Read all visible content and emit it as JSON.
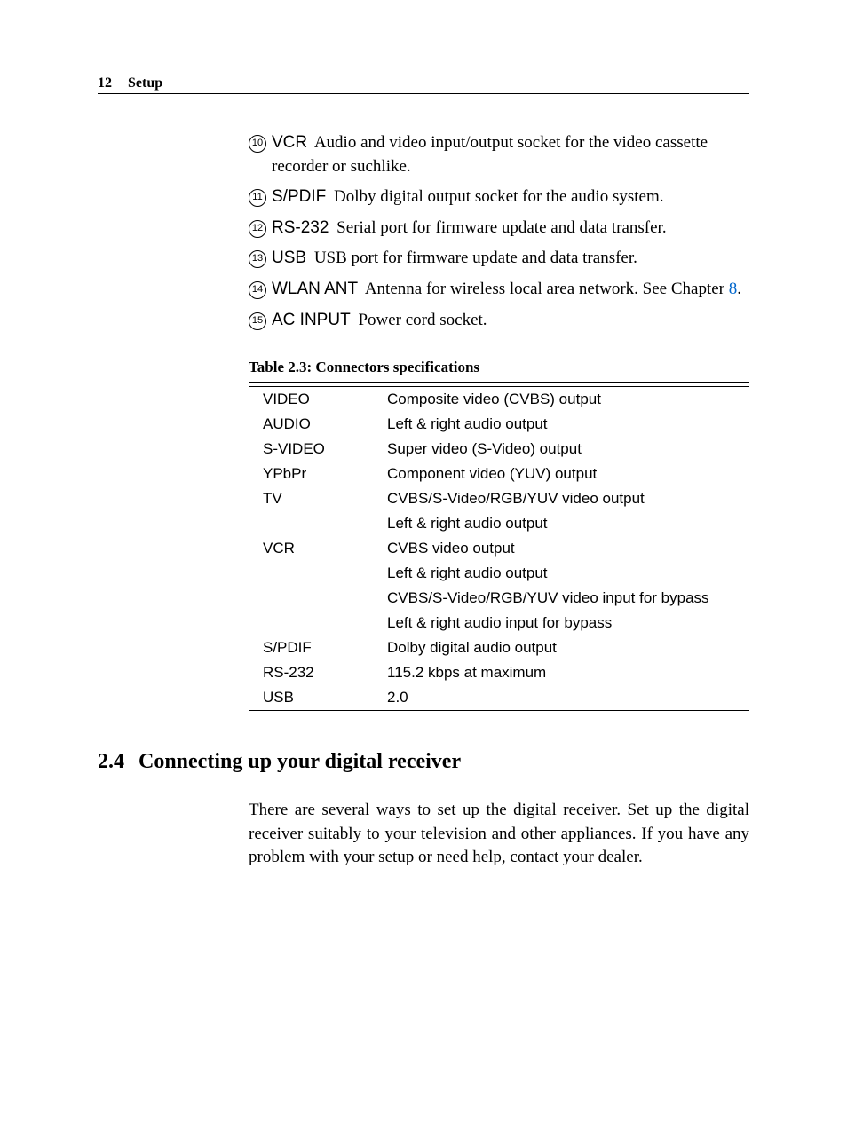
{
  "header": {
    "page_number": "12",
    "chapter": "Setup"
  },
  "definitions": [
    {
      "num": "10",
      "term": "VCR",
      "desc": "Audio and video input/output socket for the video cassette recorder or suchlike."
    },
    {
      "num": "11",
      "term": "S/PDIF",
      "desc": "Dolby digital output socket for the audio system."
    },
    {
      "num": "12",
      "term": "RS-232",
      "desc": "Serial port for firmware update and data transfer."
    },
    {
      "num": "13",
      "term": "USB",
      "desc": "USB port for firmware update and data transfer."
    },
    {
      "num": "14",
      "term": "WLAN ANT",
      "desc_pre": "Antenna for wireless local area network. See Chapter ",
      "link": "8",
      "desc_post": "."
    },
    {
      "num": "15",
      "term": "AC INPUT",
      "desc": "Power cord socket."
    }
  ],
  "table": {
    "caption": "Table 2.3: Connectors specifications",
    "rows": [
      {
        "key": "VIDEO",
        "val": "Composite video (CVBS) output"
      },
      {
        "key": "AUDIO",
        "val": "Left & right audio output"
      },
      {
        "key": "S-VIDEO",
        "val": "Super video (S-Video) output"
      },
      {
        "key": "YPbPr",
        "val": "Component video (YUV) output"
      },
      {
        "key": "TV",
        "val": "CVBS/S-Video/RGB/YUV video output"
      },
      {
        "key": "",
        "val": "Left & right audio output"
      },
      {
        "key": "VCR",
        "val": "CVBS video output"
      },
      {
        "key": "",
        "val": "Left & right audio output"
      },
      {
        "key": "",
        "val": "CVBS/S-Video/RGB/YUV video input for bypass"
      },
      {
        "key": "",
        "val": "Left & right audio input for bypass"
      },
      {
        "key": "S/PDIF",
        "val": "Dolby digital audio output"
      },
      {
        "key": "RS-232",
        "val": "115.2 kbps at maximum"
      },
      {
        "key": "USB",
        "val": "2.0"
      }
    ]
  },
  "section": {
    "number": "2.4",
    "title": "Connecting up your digital receiver",
    "paragraph": "There are several ways to set up the digital receiver. Set up the digital receiver suitably to your television and other appliances. If you have any problem with your setup or need help, contact your dealer."
  }
}
